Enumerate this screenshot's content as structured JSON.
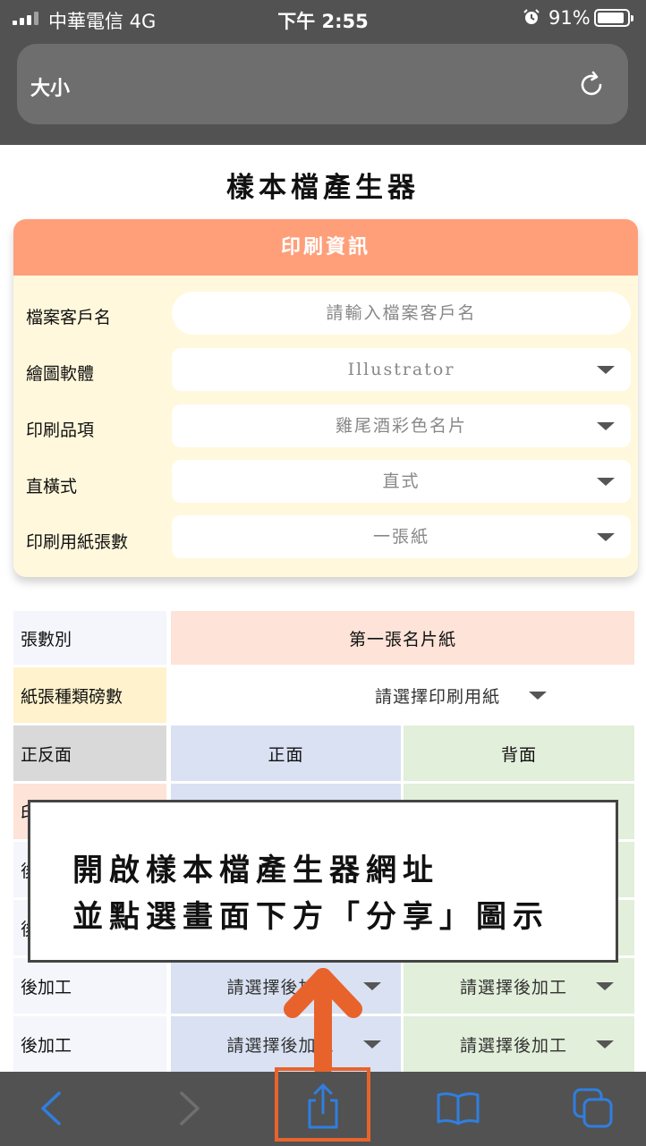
{
  "status_bar": {
    "carrier": "中華電信  4G",
    "time": "下午 2:55",
    "battery": "91%",
    "battery_level": 0.91
  },
  "browser": {
    "address_text": "大小",
    "reload_icon": "reload-icon"
  },
  "page": {
    "title": "樣本檔產生器"
  },
  "print_info": {
    "header": "印刷資訊",
    "fields": [
      {
        "label": "檔案客戶名",
        "placeholder": "請輸入檔案客戶名",
        "value": ""
      },
      {
        "label": "繪圖軟體",
        "value": "Illustrator"
      },
      {
        "label": "印刷品項",
        "value": "雞尾酒彩色名片"
      },
      {
        "label": "直橫式",
        "value": "直式"
      },
      {
        "label": "印刷用紙張數",
        "value": "一張紙"
      }
    ]
  },
  "sheet_table": {
    "row_sheet_label": "張數別",
    "row_sheet_value": "第一張名片紙",
    "row_paper_label": "紙張種類磅數",
    "row_paper_value": "請選擇印刷用紙",
    "row_side_label": "正反面",
    "front": "正面",
    "back": "背面",
    "hidden_row_labels": [
      "印",
      "後",
      "後"
    ],
    "post_rows": [
      {
        "label": "後加工",
        "front": "請選擇後加工",
        "back": "請選擇後加工"
      },
      {
        "label": "後加工",
        "front": "請選擇後加工",
        "back": "請選擇後加工"
      }
    ]
  },
  "callout": {
    "line1": "開啟樣本檔產生器網址",
    "line2": "並點選畫面下方「分享」圖示"
  },
  "colors": {
    "accent_orange": "#ff9f7a",
    "card_bg": "#fff8dc",
    "arrow": "#e8632c",
    "ios_blue": "#2f7fe0"
  }
}
